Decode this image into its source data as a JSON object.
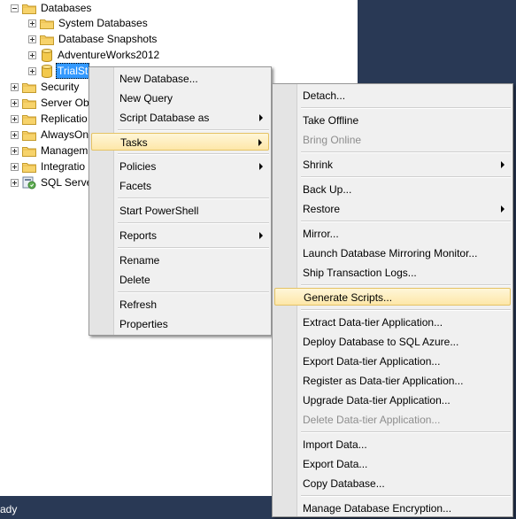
{
  "tree": {
    "items": [
      {
        "label": "Databases",
        "expander": "minus",
        "icon": "folder-icon"
      },
      {
        "label": "System Databases",
        "expander": "plus",
        "icon": "folder-icon"
      },
      {
        "label": "Database Snapshots",
        "expander": "plus",
        "icon": "folder-icon"
      },
      {
        "label": "AdventureWorks2012",
        "expander": "plus",
        "icon": "database-icon"
      },
      {
        "label": "TrialSt",
        "expander": "plus",
        "icon": "database-icon",
        "selected": true
      },
      {
        "label": "Security",
        "expander": "plus",
        "icon": "folder-icon"
      },
      {
        "label": "Server Ob",
        "expander": "plus",
        "icon": "folder-icon"
      },
      {
        "label": "Replicatio",
        "expander": "plus",
        "icon": "folder-icon"
      },
      {
        "label": "AlwaysOn",
        "expander": "plus",
        "icon": "folder-icon"
      },
      {
        "label": "Managem",
        "expander": "plus",
        "icon": "folder-icon"
      },
      {
        "label": "Integratio",
        "expander": "plus",
        "icon": "folder-icon"
      },
      {
        "label": "SQL Serve",
        "expander": "plus",
        "icon": "sql-agent-icon"
      }
    ]
  },
  "status": {
    "text": "ady"
  },
  "context_menu": {
    "items": [
      {
        "label": "New Database..."
      },
      {
        "label": "New Query"
      },
      {
        "label": "Script Database as",
        "submenu": true
      },
      {
        "label": "Tasks",
        "submenu": true,
        "highlighted": true
      },
      {
        "label": "Policies",
        "submenu": true
      },
      {
        "label": "Facets"
      },
      {
        "label": "Start PowerShell"
      },
      {
        "label": "Reports",
        "submenu": true
      },
      {
        "label": "Rename"
      },
      {
        "label": "Delete"
      },
      {
        "label": "Refresh"
      },
      {
        "label": "Properties"
      }
    ]
  },
  "tasks_menu": {
    "items": [
      {
        "label": "Detach..."
      },
      {
        "label": "Take Offline"
      },
      {
        "label": "Bring Online",
        "disabled": true
      },
      {
        "label": "Shrink",
        "submenu": true
      },
      {
        "label": "Back Up..."
      },
      {
        "label": "Restore",
        "submenu": true
      },
      {
        "label": "Mirror..."
      },
      {
        "label": "Launch Database Mirroring Monitor..."
      },
      {
        "label": "Ship Transaction Logs..."
      },
      {
        "label": "Generate Scripts...",
        "highlighted": true
      },
      {
        "label": "Extract Data-tier Application..."
      },
      {
        "label": "Deploy Database to SQL Azure..."
      },
      {
        "label": "Export Data-tier Application..."
      },
      {
        "label": "Register as Data-tier Application..."
      },
      {
        "label": "Upgrade Data-tier Application..."
      },
      {
        "label": "Delete Data-tier Application...",
        "disabled": true
      },
      {
        "label": "Import Data..."
      },
      {
        "label": "Export Data..."
      },
      {
        "label": "Copy Database..."
      },
      {
        "label": "Manage Database Encryption..."
      }
    ]
  },
  "colors": {
    "shell": "#293955",
    "menu_bg": "#f0f0f0",
    "highlight": "#fde7a8",
    "selection": "#3399ff"
  }
}
